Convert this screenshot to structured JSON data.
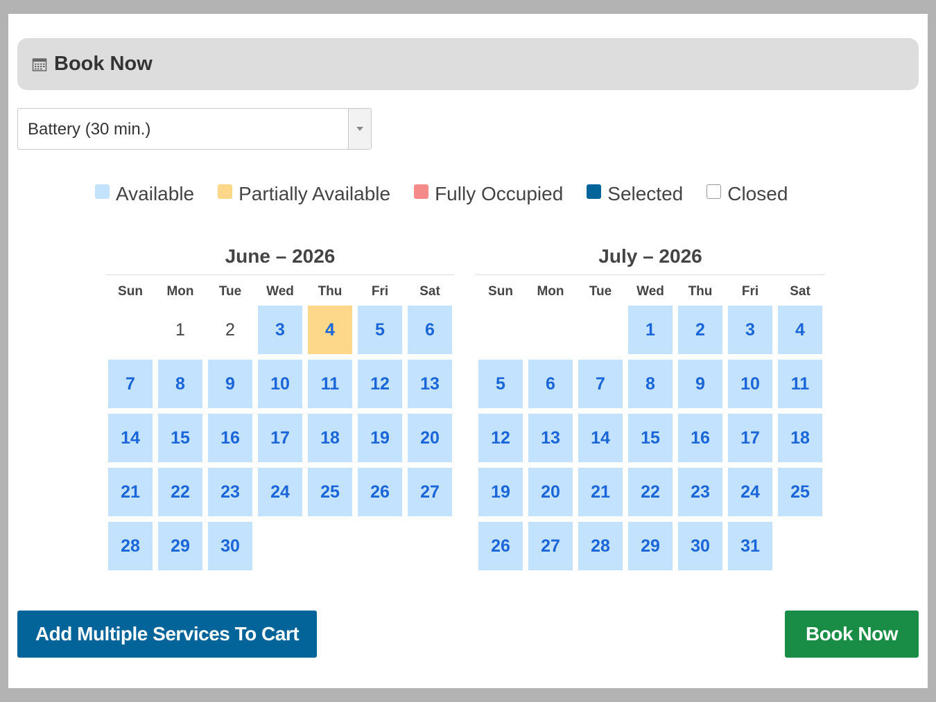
{
  "header": {
    "title": "Book Now",
    "icon": "calendar-icon"
  },
  "service_select": {
    "value": "Battery (30 min.)"
  },
  "legend": [
    {
      "label": "Available",
      "color": "#c3e2fd",
      "border": "#c3e2fd"
    },
    {
      "label": "Partially Available",
      "color": "#fdd78a",
      "border": "#fdd78a"
    },
    {
      "label": "Fully Occupied",
      "color": "#f58a8a",
      "border": "#f58a8a"
    },
    {
      "label": "Selected",
      "color": "#03649a",
      "border": "#03649a"
    },
    {
      "label": "Closed",
      "color": "#ffffff",
      "border": "#999999"
    }
  ],
  "calendars": [
    {
      "title": "June – 2026",
      "weekdays": [
        "Sun",
        "Mon",
        "Tue",
        "Wed",
        "Thu",
        "Fri",
        "Sat"
      ],
      "weeks": [
        [
          null,
          {
            "d": "1",
            "s": "past"
          },
          {
            "d": "2",
            "s": "past"
          },
          {
            "d": "3",
            "s": "available"
          },
          {
            "d": "4",
            "s": "partial"
          },
          {
            "d": "5",
            "s": "available"
          },
          {
            "d": "6",
            "s": "available"
          }
        ],
        [
          {
            "d": "7",
            "s": "available"
          },
          {
            "d": "8",
            "s": "available"
          },
          {
            "d": "9",
            "s": "available"
          },
          {
            "d": "10",
            "s": "available"
          },
          {
            "d": "11",
            "s": "available"
          },
          {
            "d": "12",
            "s": "available"
          },
          {
            "d": "13",
            "s": "available"
          }
        ],
        [
          {
            "d": "14",
            "s": "available"
          },
          {
            "d": "15",
            "s": "available"
          },
          {
            "d": "16",
            "s": "available"
          },
          {
            "d": "17",
            "s": "available"
          },
          {
            "d": "18",
            "s": "available"
          },
          {
            "d": "19",
            "s": "available"
          },
          {
            "d": "20",
            "s": "available"
          }
        ],
        [
          {
            "d": "21",
            "s": "available"
          },
          {
            "d": "22",
            "s": "available"
          },
          {
            "d": "23",
            "s": "available"
          },
          {
            "d": "24",
            "s": "available"
          },
          {
            "d": "25",
            "s": "available"
          },
          {
            "d": "26",
            "s": "available"
          },
          {
            "d": "27",
            "s": "available"
          }
        ],
        [
          {
            "d": "28",
            "s": "available"
          },
          {
            "d": "29",
            "s": "available"
          },
          {
            "d": "30",
            "s": "available"
          },
          null,
          null,
          null,
          null
        ]
      ]
    },
    {
      "title": "July – 2026",
      "weekdays": [
        "Sun",
        "Mon",
        "Tue",
        "Wed",
        "Thu",
        "Fri",
        "Sat"
      ],
      "weeks": [
        [
          null,
          null,
          null,
          {
            "d": "1",
            "s": "available"
          },
          {
            "d": "2",
            "s": "available"
          },
          {
            "d": "3",
            "s": "available"
          },
          {
            "d": "4",
            "s": "available"
          }
        ],
        [
          {
            "d": "5",
            "s": "available"
          },
          {
            "d": "6",
            "s": "available"
          },
          {
            "d": "7",
            "s": "available"
          },
          {
            "d": "8",
            "s": "available"
          },
          {
            "d": "9",
            "s": "available"
          },
          {
            "d": "10",
            "s": "available"
          },
          {
            "d": "11",
            "s": "available"
          }
        ],
        [
          {
            "d": "12",
            "s": "available"
          },
          {
            "d": "13",
            "s": "available"
          },
          {
            "d": "14",
            "s": "available"
          },
          {
            "d": "15",
            "s": "available"
          },
          {
            "d": "16",
            "s": "available"
          },
          {
            "d": "17",
            "s": "available"
          },
          {
            "d": "18",
            "s": "available"
          }
        ],
        [
          {
            "d": "19",
            "s": "available"
          },
          {
            "d": "20",
            "s": "available"
          },
          {
            "d": "21",
            "s": "available"
          },
          {
            "d": "22",
            "s": "available"
          },
          {
            "d": "23",
            "s": "available"
          },
          {
            "d": "24",
            "s": "available"
          },
          {
            "d": "25",
            "s": "available"
          }
        ],
        [
          {
            "d": "26",
            "s": "available"
          },
          {
            "d": "27",
            "s": "available"
          },
          {
            "d": "28",
            "s": "available"
          },
          {
            "d": "29",
            "s": "available"
          },
          {
            "d": "30",
            "s": "available"
          },
          {
            "d": "31",
            "s": "available"
          },
          null
        ]
      ]
    }
  ],
  "buttons": {
    "add_multiple": "Add Multiple Services To Cart",
    "book_now": "Book Now"
  }
}
